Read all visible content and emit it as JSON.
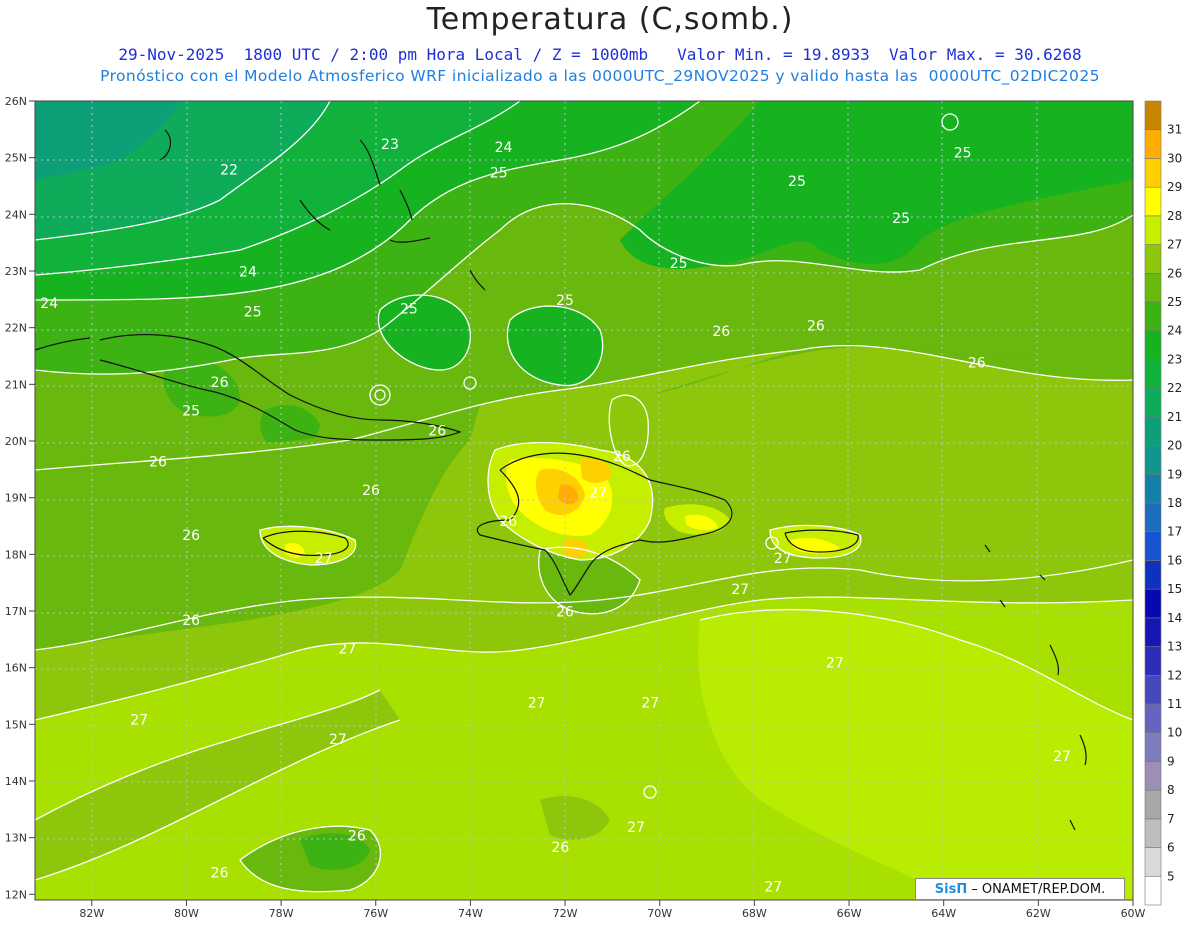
{
  "header": {
    "title": "Temperatura (C,somb.)",
    "line1": "29-Nov-2025  1800 UTC / 2:00 pm Hora Local / Z = 1000mb   Valor Min. = 19.8933  Valor Max. = 30.6268",
    "line2": "Pronóstico con el Modelo Atmosferico WRF inicializado a las 0000UTC_29NOV2025 y valido hasta las  0000UTC_02DIC2025"
  },
  "axes": {
    "lat_labels": [
      "26N",
      "25N",
      "24N",
      "23N",
      "22N",
      "21N",
      "20N",
      "19N",
      "18N",
      "17N",
      "16N",
      "15N",
      "14N",
      "13N",
      "12N"
    ],
    "lon_labels": [
      "82W",
      "80W",
      "78W",
      "76W",
      "74W",
      "72W",
      "70W",
      "68W",
      "66W",
      "64W",
      "62W",
      "60W"
    ]
  },
  "contour_labels": [
    {
      "text": "23",
      "lat": 25.15,
      "lon": -75.7
    },
    {
      "text": "24",
      "lat": 25.1,
      "lon": -73.3
    },
    {
      "text": "22",
      "lat": 24.7,
      "lon": -79.1
    },
    {
      "text": "25",
      "lat": 24.65,
      "lon": -73.4
    },
    {
      "text": "25",
      "lat": 24.5,
      "lon": -67.1
    },
    {
      "text": "25",
      "lat": 25.0,
      "lon": -63.6
    },
    {
      "text": "25",
      "lat": 23.85,
      "lon": -64.9
    },
    {
      "text": "24",
      "lat": 22.9,
      "lon": -78.7
    },
    {
      "text": "25",
      "lat": 23.05,
      "lon": -69.6
    },
    {
      "text": "24",
      "lat": 22.35,
      "lon": -82.9
    },
    {
      "text": "25",
      "lat": 22.2,
      "lon": -78.6
    },
    {
      "text": "25",
      "lat": 22.25,
      "lon": -75.3
    },
    {
      "text": "25",
      "lat": 22.4,
      "lon": -72.0
    },
    {
      "text": "26",
      "lat": 21.85,
      "lon": -68.7
    },
    {
      "text": "26",
      "lat": 21.95,
      "lon": -66.7
    },
    {
      "text": "26",
      "lat": 21.3,
      "lon": -63.3
    },
    {
      "text": "26",
      "lat": 20.95,
      "lon": -79.3
    },
    {
      "text": "25",
      "lat": 20.45,
      "lon": -79.9
    },
    {
      "text": "26",
      "lat": 20.1,
      "lon": -74.7
    },
    {
      "text": "26",
      "lat": 19.65,
      "lon": -70.8
    },
    {
      "text": "26",
      "lat": 19.55,
      "lon": -80.6
    },
    {
      "text": "26",
      "lat": 19.05,
      "lon": -76.1
    },
    {
      "text": "27",
      "lat": 19.0,
      "lon": -71.3
    },
    {
      "text": "26",
      "lat": 18.5,
      "lon": -73.2
    },
    {
      "text": "26",
      "lat": 18.25,
      "lon": -79.9
    },
    {
      "text": "27",
      "lat": 17.85,
      "lon": -77.1
    },
    {
      "text": "27",
      "lat": 17.85,
      "lon": -67.4
    },
    {
      "text": "27",
      "lat": 17.3,
      "lon": -68.3
    },
    {
      "text": "26",
      "lat": 16.9,
      "lon": -72.0
    },
    {
      "text": "26",
      "lat": 16.75,
      "lon": -79.9
    },
    {
      "text": "27",
      "lat": 16.25,
      "lon": -76.6
    },
    {
      "text": "27",
      "lat": 16.0,
      "lon": -66.3
    },
    {
      "text": "27",
      "lat": 15.3,
      "lon": -72.6
    },
    {
      "text": "27",
      "lat": 15.3,
      "lon": -70.2
    },
    {
      "text": "27",
      "lat": 15.0,
      "lon": -81.0
    },
    {
      "text": "27",
      "lat": 14.65,
      "lon": -76.8
    },
    {
      "text": "27",
      "lat": 14.35,
      "lon": -61.5
    },
    {
      "text": "27",
      "lat": 13.1,
      "lon": -70.5
    },
    {
      "text": "26",
      "lat": 12.95,
      "lon": -76.4
    },
    {
      "text": "26",
      "lat": 12.75,
      "lon": -72.1
    },
    {
      "text": "26",
      "lat": 12.3,
      "lon": -79.3
    },
    {
      "text": "27",
      "lat": 12.05,
      "lon": -67.6
    }
  ],
  "colorbar": {
    "labels": [
      "5",
      "6",
      "7",
      "8",
      "9",
      "10",
      "11",
      "12",
      "13",
      "14",
      "15",
      "16",
      "17",
      "18",
      "19",
      "20",
      "21",
      "22",
      "23",
      "24",
      "25",
      "26",
      "27",
      "28",
      "29",
      "30",
      "31"
    ],
    "colors": [
      "#ffffff",
      "#d9d9d9",
      "#bdbdbd",
      "#a8a8a8",
      "#9b8fb8",
      "#7d7dbd",
      "#6565c0",
      "#4848bd",
      "#2d2dba",
      "#1616b5",
      "#0808b0",
      "#1030c0",
      "#1854cf",
      "#1a6ebd",
      "#1480a8",
      "#10958f",
      "#0d9f78",
      "#0eab5a",
      "#10b23b",
      "#16b21f",
      "#3db213",
      "#68b80d",
      "#8ec60b",
      "#c6ef00",
      "#ffff00",
      "#ffd000",
      "#ffad00",
      "#c88500"
    ]
  },
  "credit": {
    "brand": "SisΠ",
    "text": "– ONAMET/REP.DOM."
  }
}
